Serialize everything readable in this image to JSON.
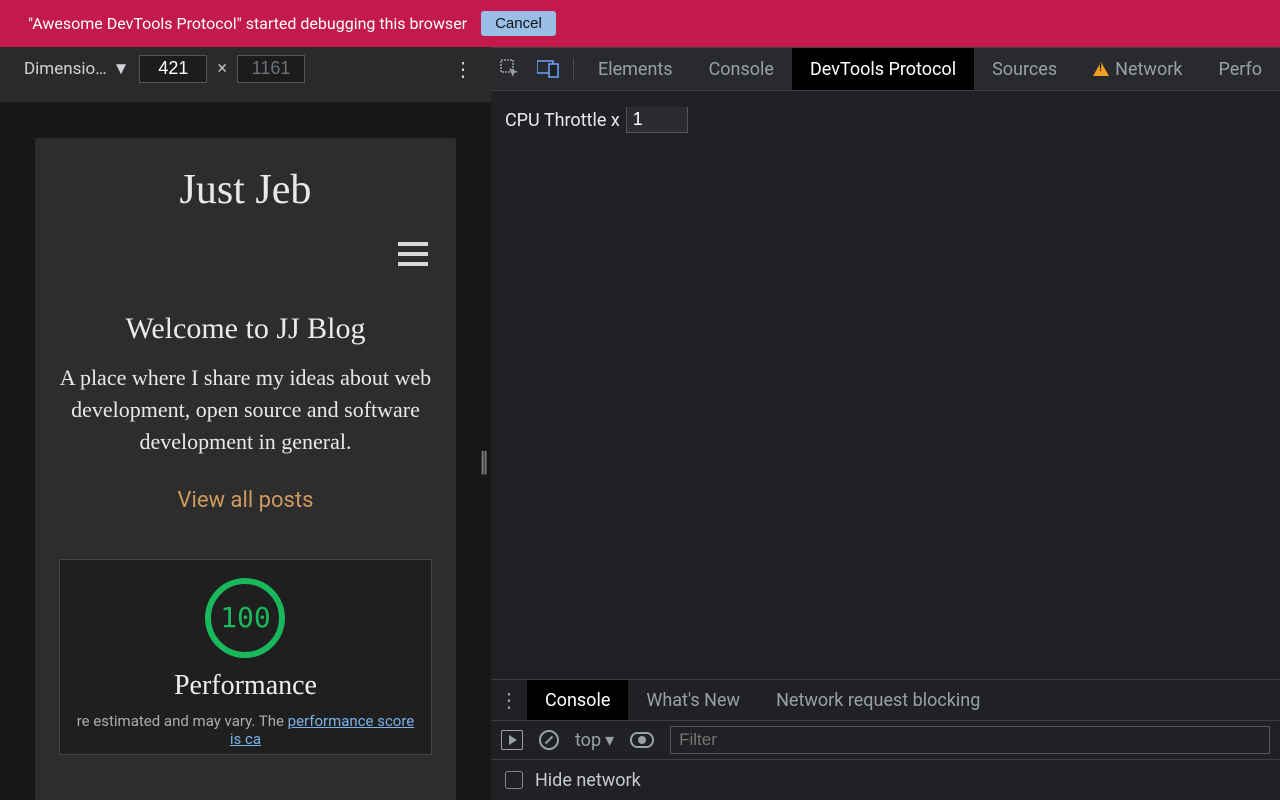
{
  "debug_bar": {
    "message": "\"Awesome DevTools Protocol\" started debugging this browser",
    "cancel": "Cancel"
  },
  "device_toolbar": {
    "dropdown_label": "Dimensio…",
    "width": "421",
    "height": "1161"
  },
  "site": {
    "title": "Just Jeb",
    "welcome_heading": "Welcome to JJ Blog",
    "blurb": "A place where I share my ideas about web development, open source and software development in general.",
    "view_all": "View all posts",
    "perf_score": "100",
    "perf_title": "Performance",
    "perf_note_prefix": "re estimated and may vary. The ",
    "perf_note_link": "performance score is ca"
  },
  "devtools": {
    "tabs": {
      "elements": "Elements",
      "console": "Console",
      "protocol": "DevTools Protocol",
      "sources": "Sources",
      "network": "Network",
      "performance": "Perfo"
    },
    "throttle_label": "CPU Throttle x",
    "throttle_value": "1"
  },
  "drawer": {
    "tabs": {
      "console": "Console",
      "whatsnew": "What's New",
      "netblock": "Network request blocking"
    },
    "context": "top",
    "filter_placeholder": "Filter",
    "hide_network": "Hide network"
  }
}
